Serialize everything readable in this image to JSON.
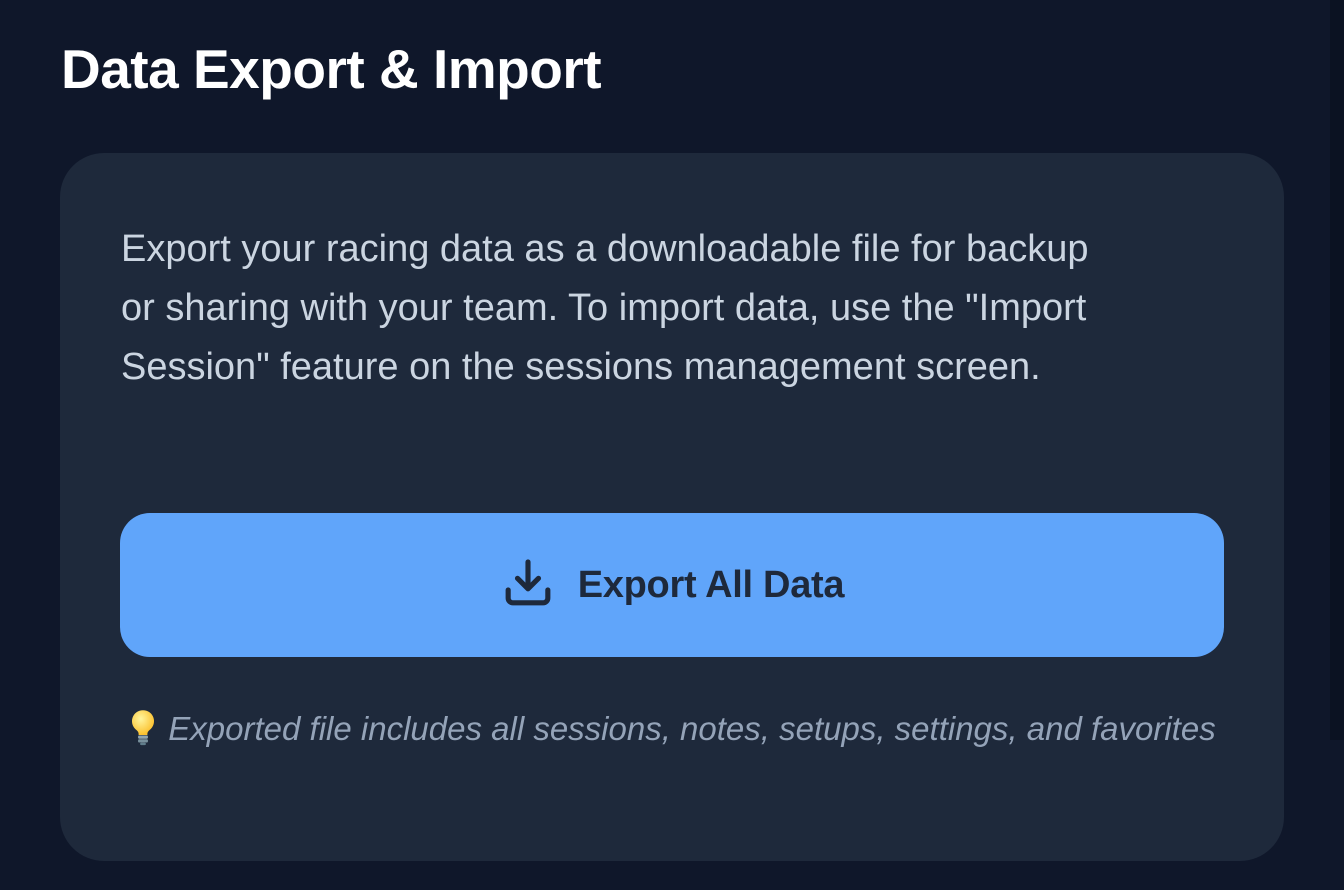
{
  "section": {
    "title": "Data Export & Import"
  },
  "card": {
    "description": "Export your racing data as a downloadable file for backup or sharing with your team. To import data, use the \"Import Session\" feature on the sessions management screen.",
    "export_button": {
      "label": "Export All Data",
      "icon": "download-icon"
    },
    "hint": {
      "icon": "lightbulb-icon",
      "text": "Exported file includes all sessions, notes, setups, settings, and favorites"
    }
  },
  "colors": {
    "background": "#0f172a",
    "card": "#1e293b",
    "accent": "#60a5fa",
    "title": "#ffffff",
    "body_text": "#cbd5e1",
    "hint_text": "#94a3b8"
  }
}
